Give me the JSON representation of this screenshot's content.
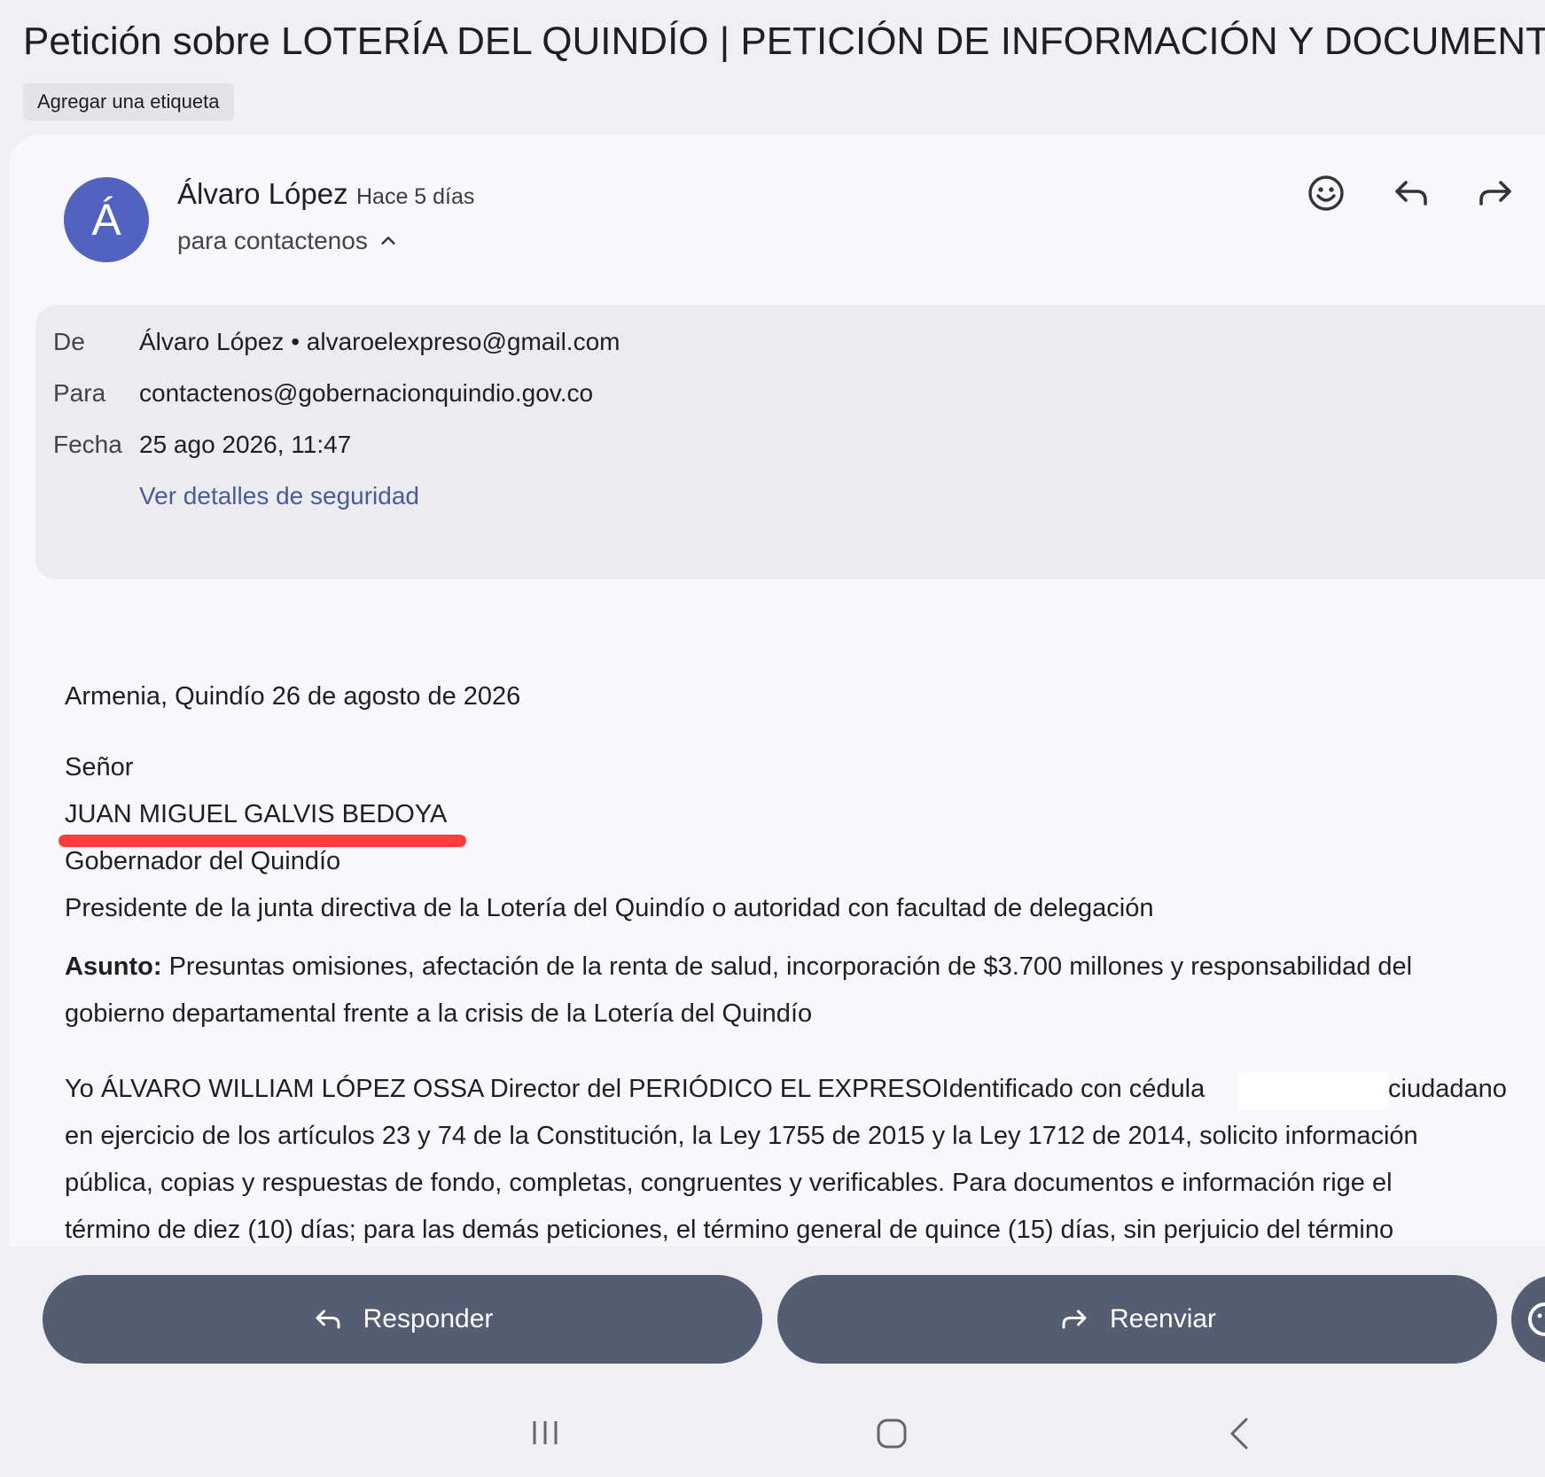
{
  "email": {
    "subject": "Petición sobre LOTERÍA DEL QUINDÍO | PETICIÓN DE INFORMACIÓN Y DOCUMENTOS",
    "add_label": "Agregar una etiqueta",
    "sender": {
      "initial": "Á",
      "name": "Álvaro López",
      "time": "Hace 5 días",
      "recipient_summary": "para contactenos"
    },
    "details": {
      "from_label": "De",
      "from_value": "Álvaro López • alvaroelexpreso@gmail.com",
      "to_label": "Para",
      "to_value": "contactenos@gobernacionquindio.gov.co",
      "date_label": "Fecha",
      "date_value": "25 ago 2026, 11:47",
      "security_link": "Ver detalles de seguridad"
    },
    "body": {
      "date_line": "Armenia, Quindío 26 de agosto de 2026",
      "salutation": "Señor",
      "addressee_name": "JUAN MIGUEL GALVIS BEDOYA",
      "addressee_title": "Gobernador del Quindío",
      "addressee_role": "Presidente de la junta directiva de la Lotería del Quindío o autoridad con facultad de delegación",
      "subject_label": "Asunto:",
      "subject_line1": " Presuntas omisiones, afectación de la renta de salud, incorporación de $3.700 millones y responsabilidad del",
      "subject_line2": "gobierno departamental frente a la crisis de la Lotería del Quindío",
      "para1_line1a": "Yo ÁLVARO WILLIAM LÓPEZ OSSA Director del PERIÓDICO EL EXPRESOIdentificado con cédula",
      "para1_line1b": "ciudadano",
      "para1_line2": "en ejercicio de los artículos 23 y 74 de la Constitución, la Ley 1755 de 2015 y la Ley 1712 de 2014, solicito información",
      "para1_line3": "pública, copias y respuestas de fondo, completas, congruentes y verificables. Para documentos e información rige el",
      "para1_line4": "término de diez (10) días; para las demás peticiones, el término general de quince (15) días, sin perjuicio del término"
    }
  },
  "actions": {
    "reply": "Responder",
    "forward": "Reenviar"
  },
  "colors": {
    "avatar": "#5262bf",
    "pill": "#555d73",
    "underline": "#ff3b3b",
    "link": "#4a5b9a"
  }
}
